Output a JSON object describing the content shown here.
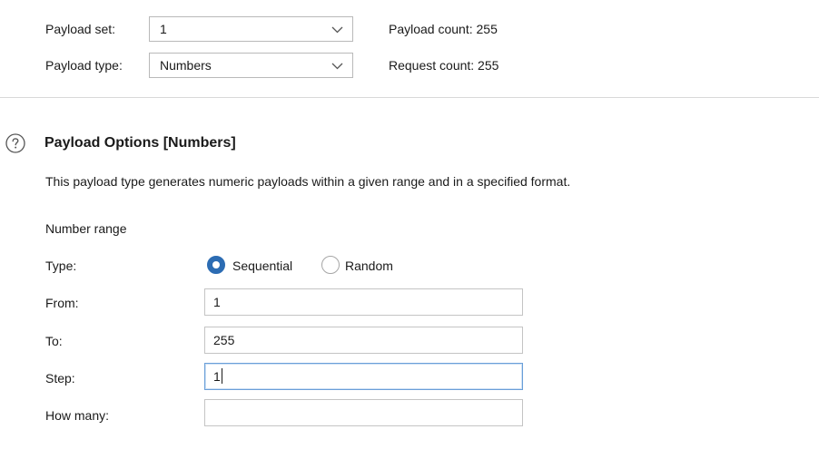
{
  "payload_header": {
    "payload_set_label": "Payload set:",
    "payload_set_value": "1",
    "payload_type_label": "Payload type:",
    "payload_type_value": "Numbers",
    "payload_count": "Payload count: 255",
    "request_count": "Request count: 255"
  },
  "payload_options": {
    "help_icon": "question-circle-icon",
    "title": "Payload Options [Numbers]",
    "description": "This payload type generates numeric payloads within a given range and in a specified format.",
    "section_label": "Number range",
    "type_label": "Type:",
    "type_options": [
      "Sequential",
      "Random"
    ],
    "type_selected": "Sequential",
    "from_label": "From:",
    "from_value": "1",
    "to_label": "To:",
    "to_value": "255",
    "step_label": "Step:",
    "step_value": "1",
    "how_many_label": "How many:",
    "how_many_value": ""
  },
  "colors": {
    "accent": "#2c6cb3",
    "focus_border": "#6a9fd8",
    "input_border": "#c4c4c4",
    "divider": "#d9d9d9"
  }
}
